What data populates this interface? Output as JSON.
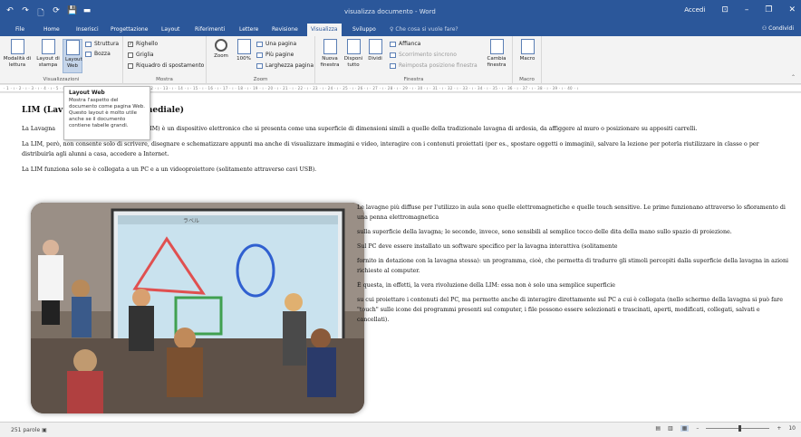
{
  "titlebar": {
    "doc_title": "visualizza documento - Word",
    "signin": "Accedi",
    "qat": [
      "↶",
      "↷",
      "🗋",
      "⟳",
      "💾",
      "▬"
    ]
  },
  "tabs": {
    "items": [
      "File",
      "Home",
      "Inserisci",
      "Progettazione",
      "Layout",
      "Riferimenti",
      "Lettere",
      "Revisione",
      "Visualizza",
      "Sviluppo"
    ],
    "active": "Visualizza",
    "tell_me": "Che cosa si vuole fare?",
    "share": "Condividi"
  },
  "ribbon": {
    "visualizzazioni": {
      "label": "Visualizzazioni",
      "read_mode": "Modalità di lettura",
      "print_layout": "Layout di stampa",
      "web_layout": "Layout Web",
      "structure": "Struttura",
      "draft": "Bozza"
    },
    "mostra": {
      "label": "Mostra",
      "ruler": "Righello",
      "gridlines": "Griglia",
      "nav_pane": "Riquadro di spostamento"
    },
    "zoom": {
      "label": "Zoom",
      "zoom": "Zoom",
      "hundred": "100%",
      "one_page": "Una pagina",
      "multi_pages": "Più pagine",
      "page_width": "Larghezza pagina"
    },
    "finestra": {
      "label": "Finestra",
      "new_window": "Nuova finestra",
      "arrange_all": "Disponi tutto",
      "split": "Dividi",
      "side_by_side": "Affianca",
      "sync_scroll": "Scorrimento sincrono",
      "reset_pos": "Reimposta posizione finestra",
      "switch_windows": "Cambia finestra"
    },
    "macro": {
      "label": "Macro",
      "macro": "Macro"
    }
  },
  "tooltip": {
    "title": "Layout Web",
    "body": "Mostra l'aspetto del documento come pagina Web. Questo layout è molto utile anche se il documento contiene tabelle grandi."
  },
  "document": {
    "heading_start": "LIM (Lav",
    "heading_end": "timediale)",
    "p1_start": "La Lavagna",
    "p1_end": "LIM) è un dispositivo elettronico che si presenta come una superficie di dimensioni simili a quelle della tradizionale lavagna di ardesia, da affiggere al muro o posizionare su appositi carrelli.",
    "p2": "La LIM, però, non consente solo di scrivere, disegnare e schematizzare appunti ma anche di visualizzare immagini e video, interagire con i contenuti proiettati (per es., spostare oggetti o immagini), salvare la lezione per poterla riutilizzare in classe o per distribuirla agli alunni a casa, accedere a Internet.",
    "p3": "La LIM funziona solo se è collegata a un PC e a un videoproiettore (solitamente attraverso cavi USB).",
    "right": [
      "Le lavagne più diffuse per l'utilizzo in aula sono quelle elettromagnetiche e quelle touch sensitive. Le prime funzionano attraverso lo sfioramento di una penna elettromagnetica",
      "sulla superficie della lavagna; le seconde, invece, sono sensibili al semplice tocco delle dita della mano sullo spazio di proiezione.",
      "Sul PC deve essere installato un software specifico per la lavagna interattiva (solitamente",
      "fornito in dotazione con la lavagna stessa): un programma, cioè, che permetta di tradurre gli stimoli percepiti dalla superficie della lavagna in azioni richieste al computer.",
      "È questa, in effetti, la vera rivoluzione della LIM: essa non è solo una semplice superficie",
      "su cui proiettare i contenuti del PC, ma permette anche di interagire direttamente sul PC a cui è collegata (nello schermo della lavagna si può fare \"touch\" sulle icone dei programmi presenti sul computer, i file possono essere selezionati e trascinati, aperti, modificati, collegati, salvati e cancellati)."
    ],
    "photo_board_label": "ラベル"
  },
  "status": {
    "word_count": "251 parole",
    "zoom": "10"
  },
  "colors": {
    "word_blue": "#2b579a"
  }
}
